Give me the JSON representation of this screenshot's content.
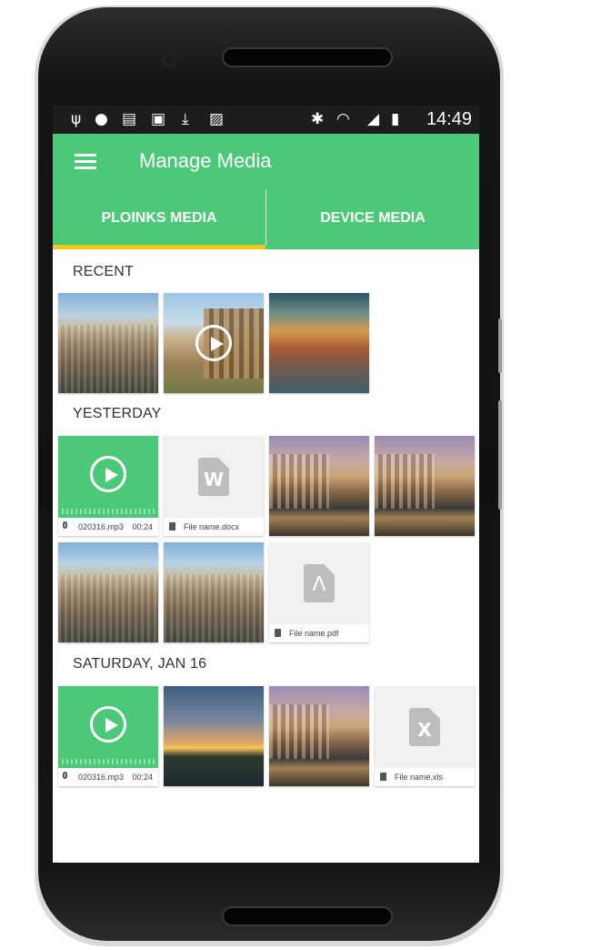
{
  "status_bar": {
    "time": "14:49",
    "left_icons": [
      "usb-icon",
      "chat-icon",
      "no-sim-icon",
      "image-icon",
      "download-icon",
      "clipboard-icon"
    ],
    "right_icons": [
      "bluetooth-icon",
      "wifi-icon",
      "signal-icon",
      "battery-icon"
    ]
  },
  "app_bar": {
    "title": "Manage Media",
    "menu_icon": "menu-icon",
    "color": "#4cc879"
  },
  "tabs": [
    {
      "label": "PLOINKS MEDIA",
      "selected": true
    },
    {
      "label": "DEVICE MEDIA",
      "selected": false
    }
  ],
  "accent": {
    "tab_indicator": "#f7c519",
    "audio_tile": "#4cc879"
  },
  "sections": [
    {
      "title": "RECENT",
      "items": [
        {
          "type": "photo",
          "subject": "city-panorama"
        },
        {
          "type": "video",
          "subject": "colosseum"
        },
        {
          "type": "photo",
          "subject": "mountain-sunset"
        }
      ]
    },
    {
      "title": "YESTERDAY",
      "items": [
        {
          "type": "audio",
          "name": "020316.mp3",
          "duration": "00:24"
        },
        {
          "type": "file",
          "icon": "word-doc-icon",
          "letter": "W",
          "name": "File name.docx"
        },
        {
          "type": "photo",
          "subject": "venice-canal"
        },
        {
          "type": "photo",
          "subject": "venice-canal"
        },
        {
          "type": "photo",
          "subject": "city-panorama"
        },
        {
          "type": "photo",
          "subject": "city-panorama"
        },
        {
          "type": "file",
          "icon": "pdf-icon",
          "name": "File name.pdf"
        }
      ]
    },
    {
      "title": "SATURDAY, JAN 16",
      "items": [
        {
          "type": "audio",
          "name": "020316.mp3",
          "duration": "00:24"
        },
        {
          "type": "photo",
          "subject": "coast-sunset"
        },
        {
          "type": "photo",
          "subject": "venice-canal"
        },
        {
          "type": "file",
          "icon": "excel-icon",
          "letter": "X",
          "name": "File name.xls"
        }
      ]
    }
  ]
}
